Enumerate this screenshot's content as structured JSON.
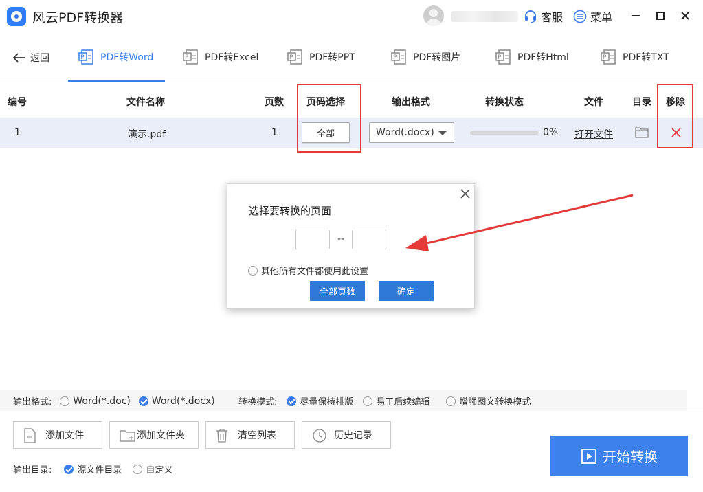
{
  "app": {
    "title": "风云PDF转换器"
  },
  "header": {
    "service_label": "客服",
    "menu_label": "菜单"
  },
  "nav": {
    "back_label": "返回",
    "tabs": [
      {
        "label": "PDF转Word",
        "active": true
      },
      {
        "label": "PDF转Excel",
        "active": false
      },
      {
        "label": "PDF转PPT",
        "active": false
      },
      {
        "label": "PDF转图片",
        "active": false
      },
      {
        "label": "PDF转Html",
        "active": false
      },
      {
        "label": "PDF转TXT",
        "active": false
      }
    ]
  },
  "table": {
    "headers": {
      "index": "编号",
      "filename": "文件名称",
      "pages": "页数",
      "page_select": "页码选择",
      "format": "输出格式",
      "status": "转换状态",
      "file": "文件",
      "dir": "目录",
      "remove": "移除"
    },
    "rows": [
      {
        "index": "1",
        "filename": "演示.pdf",
        "pages": "1",
        "page_select_label": "全部",
        "format": "Word(.docx)",
        "progress_percent": 0,
        "progress_text": "0%",
        "open_file_label": "打开文件"
      }
    ]
  },
  "dialog": {
    "title": "选择要转换的页面",
    "from_value": "",
    "to_value": "",
    "separator": "--",
    "apply_all_label": "其他所有文件都使用此设置",
    "apply_all_checked": false,
    "all_pages_button": "全部页数",
    "confirm_button": "确定"
  },
  "options": {
    "format_label": "输出格式:",
    "format_options": [
      {
        "label": "Word(*.doc)",
        "checked": false
      },
      {
        "label": "Word(*.docx)",
        "checked": true
      }
    ],
    "mode_label": "转换模式:",
    "mode_options": [
      {
        "label": "尽量保持排版",
        "checked": true
      },
      {
        "label": "易于后续编辑",
        "checked": false
      },
      {
        "label": "增强图文转换模式",
        "checked": false
      }
    ],
    "output_dir_label": "输出目录:",
    "output_dir_options": [
      {
        "label": "源文件目录",
        "checked": true
      },
      {
        "label": "自定义",
        "checked": false
      }
    ]
  },
  "actions": {
    "add_file": "添加文件",
    "add_folder": "添加文件夹",
    "clear_list": "清空列表",
    "history": "历史记录",
    "start": "开始转换"
  },
  "colors": {
    "accent": "#3a7de8",
    "annotation_red": "#e43a3a",
    "start_button": "#3d82ec",
    "row_highlight": "#e9eef8"
  }
}
